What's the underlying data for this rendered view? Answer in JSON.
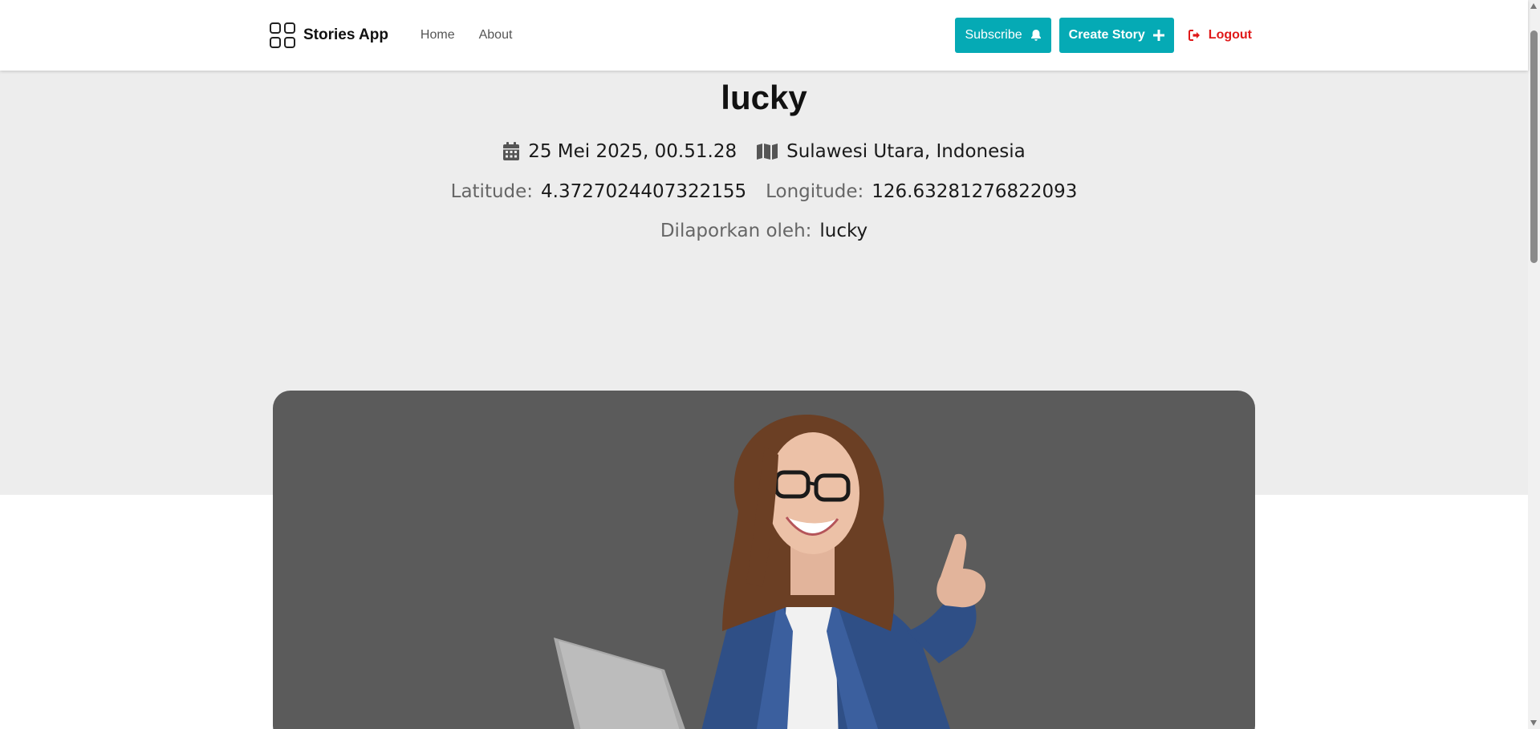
{
  "header": {
    "brand": "Stories App",
    "nav": [
      {
        "label": "Home"
      },
      {
        "label": "About"
      }
    ],
    "subscribe_label": "Subscribe",
    "create_label": "Create Story",
    "logout_label": "Logout"
  },
  "story": {
    "title": "lucky",
    "date": "25 Mei 2025, 00.51.28",
    "location": "Sulawesi Utara, Indonesia",
    "latitude_label": "Latitude:",
    "latitude": "4.3727024407322155",
    "longitude_label": "Longitude:",
    "longitude": "126.63281276822093",
    "reporter_label": "Dilaporkan oleh:",
    "reporter": "lucky"
  },
  "colors": {
    "accent": "#05aab5",
    "logout": "#e01919",
    "hero_bg": "#ededed",
    "image_bg": "#5b5b5b"
  },
  "icons": [
    "grid-logo-icon",
    "bell-icon",
    "plus-icon",
    "logout-icon",
    "calendar-icon",
    "map-icon"
  ]
}
